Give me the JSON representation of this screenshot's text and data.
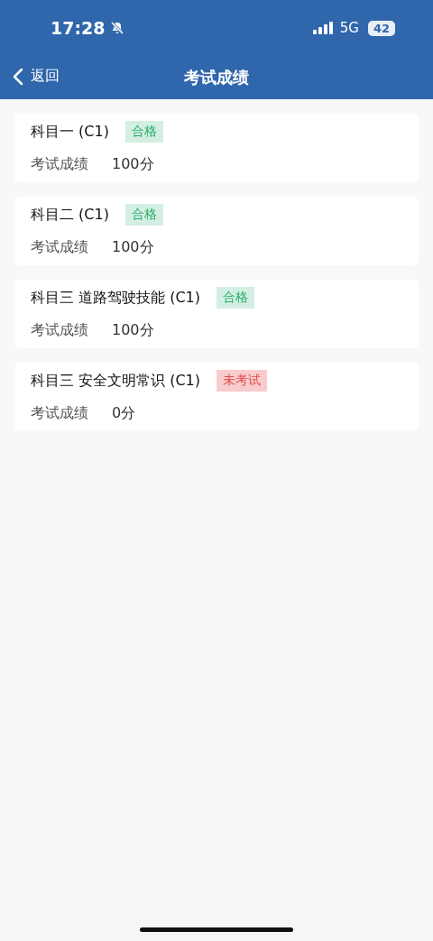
{
  "status_bar": {
    "time": "17:28",
    "network": "5G",
    "battery": "42"
  },
  "nav": {
    "back": "返回",
    "title": "考试成绩"
  },
  "subjects": [
    {
      "name": "科目一 (C1)",
      "badge": {
        "kind": "pass",
        "text": "合格"
      },
      "label": "考试成绩",
      "score": "100分"
    },
    {
      "name": "科目二 (C1)",
      "badge": {
        "kind": "pass",
        "text": "合格"
      },
      "label": "考试成绩",
      "score": "100分"
    },
    {
      "name": "科目三 道路驾驶技能 (C1)",
      "badge": {
        "kind": "pass",
        "text": "合格"
      },
      "label": "考试成绩",
      "score": "100分"
    },
    {
      "name": "科目三 安全文明常识 (C1)",
      "badge": {
        "kind": "untaken",
        "text": "未考试"
      },
      "label": "考试成绩",
      "score": "0分"
    }
  ]
}
